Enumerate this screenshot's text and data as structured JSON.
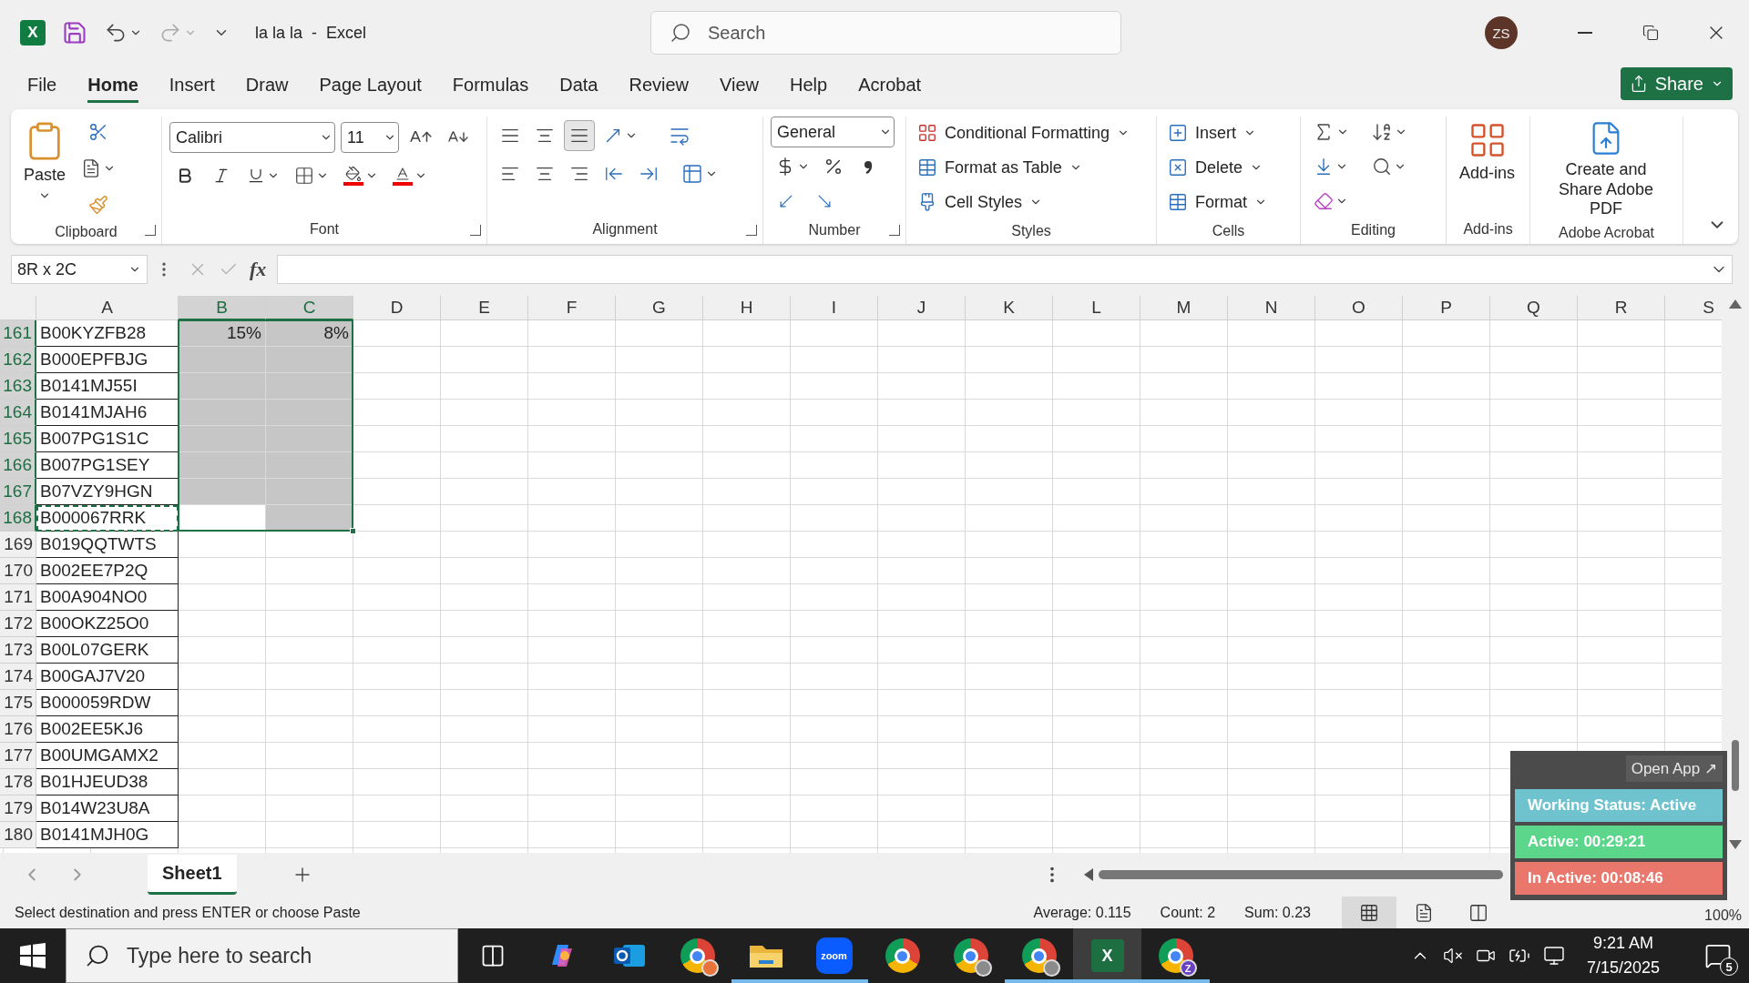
{
  "title_bar": {
    "app_logo": "X",
    "document_title": "la la la  -  Excel",
    "search_placeholder": "Search",
    "avatar": "ZS"
  },
  "menu_tabs": [
    {
      "label": "File",
      "selected": false
    },
    {
      "label": "Home",
      "selected": true
    },
    {
      "label": "Insert",
      "selected": false
    },
    {
      "label": "Draw",
      "selected": false
    },
    {
      "label": "Page Layout",
      "selected": false
    },
    {
      "label": "Formulas",
      "selected": false
    },
    {
      "label": "Data",
      "selected": false
    },
    {
      "label": "Review",
      "selected": false
    },
    {
      "label": "View",
      "selected": false
    },
    {
      "label": "Help",
      "selected": false
    },
    {
      "label": "Acrobat",
      "selected": false
    }
  ],
  "share_button": "Share",
  "ribbon": {
    "clipboard": {
      "label": "Clipboard",
      "launcher": true,
      "paste": "Paste"
    },
    "font": {
      "label": "Font",
      "launcher": true,
      "name": "Calibri",
      "size": "11"
    },
    "alignment": {
      "label": "Alignment",
      "launcher": true,
      "vertical_align": [
        {
          "kind": "top",
          "selected": false
        },
        {
          "kind": "middle",
          "selected": false
        },
        {
          "kind": "bottom",
          "selected": true
        }
      ]
    },
    "number": {
      "label": "Number",
      "launcher": true,
      "format": "General"
    },
    "styles": {
      "label": "Styles",
      "launcher": false,
      "items": [
        "Conditional Formatting",
        "Format as Table",
        "Cell Styles"
      ]
    },
    "cells": {
      "label": "Cells",
      "launcher": false,
      "items": [
        "Insert",
        "Delete",
        "Format"
      ]
    },
    "editing": {
      "label": "Editing",
      "launcher": false
    },
    "addins": {
      "label": "Add-ins",
      "launcher": false,
      "button": "Add-ins"
    },
    "acrobat": {
      "label": "Adobe Acrobat",
      "launcher": false,
      "button": "Create and Share Adobe PDF"
    }
  },
  "formula_bar": {
    "name_box": "8R x 2C",
    "function_label": "fx"
  },
  "sheet": {
    "columns": [
      {
        "label": "A",
        "selected": false
      },
      {
        "label": "B",
        "selected": true
      },
      {
        "label": "C",
        "selected": true
      },
      {
        "label": "D",
        "selected": false
      },
      {
        "label": "E",
        "selected": false
      },
      {
        "label": "F",
        "selected": false
      },
      {
        "label": "G",
        "selected": false
      },
      {
        "label": "H",
        "selected": false
      },
      {
        "label": "I",
        "selected": false
      },
      {
        "label": "J",
        "selected": false
      },
      {
        "label": "K",
        "selected": false
      },
      {
        "label": "L",
        "selected": false
      },
      {
        "label": "M",
        "selected": false
      },
      {
        "label": "N",
        "selected": false
      },
      {
        "label": "O",
        "selected": false
      },
      {
        "label": "P",
        "selected": false
      },
      {
        "label": "Q",
        "selected": false
      },
      {
        "label": "R",
        "selected": false
      },
      {
        "label": "S",
        "selected": false
      }
    ],
    "rows": [
      {
        "number": "161",
        "cells": [
          {
            "text": "B00KYZFB28",
            "selected": false,
            "copied": false
          },
          {
            "text": "15%",
            "selected": true,
            "copied": false
          },
          {
            "text": "8%",
            "selected": true,
            "copied": false
          }
        ]
      },
      {
        "number": "162",
        "cells": [
          {
            "text": "B000EPFBJG",
            "selected": false,
            "copied": false
          },
          {
            "selected": true,
            "copied": false
          },
          {
            "selected": true,
            "copied": false
          }
        ]
      },
      {
        "number": "163",
        "cells": [
          {
            "text": "B0141MJ55I",
            "selected": false,
            "copied": false
          },
          {
            "selected": true,
            "copied": false
          },
          {
            "selected": true,
            "copied": false
          }
        ]
      },
      {
        "number": "164",
        "cells": [
          {
            "text": "B0141MJAH6",
            "selected": false,
            "copied": false
          },
          {
            "selected": true,
            "copied": false
          },
          {
            "selected": true,
            "copied": false
          }
        ]
      },
      {
        "number": "165",
        "cells": [
          {
            "text": "B007PG1S1C",
            "selected": false,
            "copied": false
          },
          {
            "selected": true,
            "copied": false
          },
          {
            "selected": true,
            "copied": false
          }
        ]
      },
      {
        "number": "166",
        "cells": [
          {
            "text": "B007PG1SEY",
            "selected": false,
            "copied": false
          },
          {
            "selected": true,
            "copied": false
          },
          {
            "selected": true,
            "copied": false
          }
        ]
      },
      {
        "number": "167",
        "cells": [
          {
            "text": "B07VZY9HGN",
            "selected": false,
            "copied": false
          },
          {
            "selected": true,
            "copied": false
          },
          {
            "selected": true,
            "copied": false
          }
        ]
      },
      {
        "number": "168",
        "cells": [
          {
            "text": "B000067RRK",
            "selected": false,
            "copied": true
          },
          {
            "selected": false,
            "copied": false
          },
          {
            "selected": true,
            "copied": false
          }
        ]
      },
      {
        "number": "169",
        "cells": [
          {
            "text": "B019QQTWTS",
            "selected": false,
            "copied": false
          }
        ]
      },
      {
        "number": "170",
        "cells": [
          {
            "text": "B002EE7P2Q",
            "selected": false,
            "copied": false
          }
        ]
      },
      {
        "number": "171",
        "cells": [
          {
            "text": "B00A904NO0",
            "selected": false,
            "copied": false
          }
        ]
      },
      {
        "number": "172",
        "cells": [
          {
            "text": "B00OKZ25O0",
            "selected": false,
            "copied": false
          }
        ]
      },
      {
        "number": "173",
        "cells": [
          {
            "text": "B00L07GERK",
            "selected": false,
            "copied": false
          }
        ]
      },
      {
        "number": "174",
        "cells": [
          {
            "text": "B00GAJ7V20",
            "selected": false,
            "copied": false
          }
        ]
      },
      {
        "number": "175",
        "cells": [
          {
            "text": "B000059RDW",
            "selected": false,
            "copied": false
          }
        ]
      },
      {
        "number": "176",
        "cells": [
          {
            "text": "B002EE5KJ6",
            "selected": false,
            "copied": false
          }
        ]
      },
      {
        "number": "177",
        "cells": [
          {
            "text": "B00UMGAMX2",
            "selected": false,
            "copied": false
          }
        ]
      },
      {
        "number": "178",
        "cells": [
          {
            "text": "B01HJEUD38",
            "selected": false,
            "copied": false
          }
        ]
      },
      {
        "number": "179",
        "cells": [
          {
            "text": "B014W23U8A",
            "selected": false,
            "copied": false
          }
        ]
      },
      {
        "number": "180",
        "cells": [
          {
            "text": "B0141MJH0G",
            "selected": false,
            "copied": false
          }
        ]
      }
    ]
  },
  "sheet_tabs": [
    {
      "label": "Sheet1",
      "selected": true
    }
  ],
  "status_bar": {
    "message": "Select destination and press ENTER or choose Paste",
    "stats": [
      "Average: 0.115",
      "Count: 2",
      "Sum: 0.23"
    ],
    "views": [
      {
        "kind": "normal",
        "selected": true
      },
      {
        "kind": "page_layout",
        "selected": false
      },
      {
        "kind": "page_break",
        "selected": false
      }
    ],
    "zoom": "100%"
  },
  "tracker_widget": {
    "open_app": "Open App ↗",
    "rows": [
      {
        "text": "Working Status: Active",
        "color": "#6fc3cf"
      },
      {
        "text": "Active: 00:29:21",
        "color": "#5cd68b"
      },
      {
        "text": "In Active: 00:08:46",
        "color": "#e9776b"
      }
    ]
  },
  "taskbar": {
    "search_placeholder": "Type here to search",
    "apps": [
      {
        "kind": "taskview",
        "open": false,
        "selected": false
      },
      {
        "kind": "assistant",
        "open": false,
        "selected": false
      },
      {
        "kind": "mail",
        "open": false,
        "selected": false
      },
      {
        "kind": "browser",
        "badge": {
          "color": "#e8743b"
        },
        "open": false,
        "selected": false
      },
      {
        "kind": "folder",
        "open": true,
        "selected": false
      },
      {
        "kind": "video",
        "label": "zoom",
        "open": true,
        "selected": false
      },
      {
        "kind": "browser",
        "open": false,
        "selected": false
      },
      {
        "kind": "browser",
        "badge": {
          "color": "#8b8b8b"
        },
        "open": false,
        "selected": false
      },
      {
        "kind": "browser",
        "badge": {
          "color": "#8b8b8b"
        },
        "open": true,
        "selected": false
      },
      {
        "kind": "spreadsheet",
        "label": "X",
        "open": true,
        "selected": true
      },
      {
        "kind": "browser",
        "badge": {
          "color": "#6a3fc4",
          "text": "Z"
        },
        "open": true,
        "selected": false
      }
    ],
    "time": "9:21 AM",
    "date": "7/15/2025",
    "notifications": "5"
  }
}
